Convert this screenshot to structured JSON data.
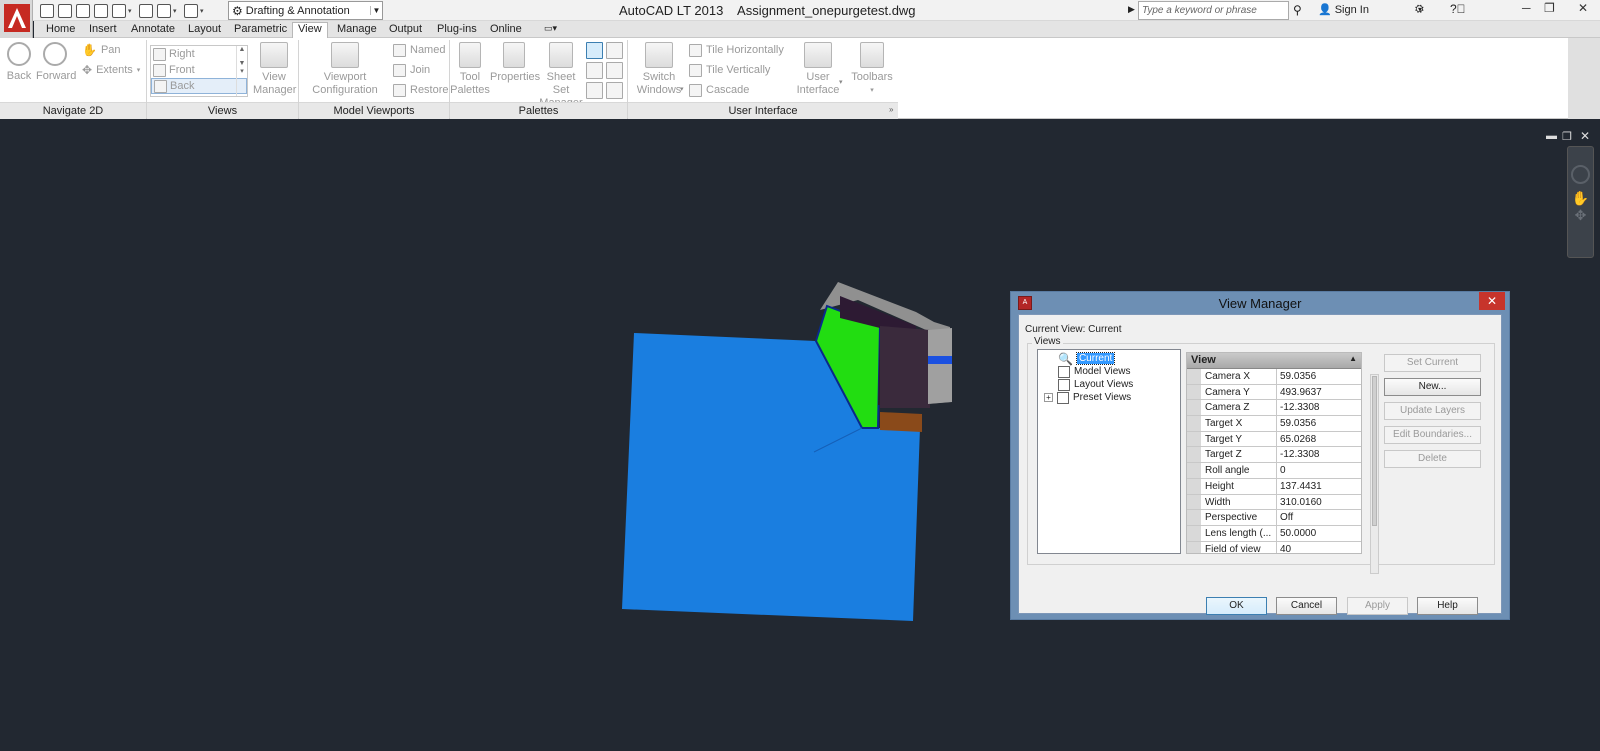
{
  "app": {
    "title": "AutoCAD LT 2013    Assignment_onepurgetest.dwg"
  },
  "workspace": {
    "value": "Drafting & Annotation"
  },
  "search": {
    "placeholder": "Type a keyword or phrase"
  },
  "account": {
    "signin": "Sign In"
  },
  "tabs": [
    "Home",
    "Insert",
    "Annotate",
    "Layout",
    "Parametric",
    "View",
    "Manage",
    "Output",
    "Plug-ins",
    "Online"
  ],
  "active_tab": "View",
  "ribbon": {
    "navigate2d": {
      "title": "Navigate 2D",
      "back": "Back",
      "forward": "Forward",
      "pan": "Pan",
      "extents": "Extents"
    },
    "views": {
      "title": "Views",
      "items": [
        "Right",
        "Front",
        "Back"
      ],
      "view_manager": [
        "View",
        "Manager"
      ]
    },
    "model_viewports": {
      "title": "Model Viewports",
      "viewport_config": [
        "Viewport",
        "Configuration"
      ],
      "named": "Named",
      "join": "Join",
      "restore": "Restore"
    },
    "palettes": {
      "title": "Palettes",
      "tool_palettes": [
        "Tool",
        "Palettes"
      ],
      "properties": "Properties",
      "sheet_set": [
        "Sheet Set",
        "Manager"
      ]
    },
    "user_interface": {
      "title": "User Interface",
      "switch_windows": [
        "Switch",
        "Windows"
      ],
      "tile_h": "Tile Horizontally",
      "tile_v": "Tile Vertically",
      "cascade": "Cascade",
      "user_interface": [
        "User",
        "Interface"
      ],
      "toolbars": "Toolbars"
    }
  },
  "dialog": {
    "title": "View Manager",
    "current_view": "Current View: Current",
    "group_label": "Views",
    "tree": [
      "Current",
      "Model Views",
      "Layout Views",
      "Preset Views"
    ],
    "props_header": "View",
    "props": [
      {
        "name": "Camera X",
        "value": "59.0356"
      },
      {
        "name": "Camera Y",
        "value": "493.9637"
      },
      {
        "name": "Camera Z",
        "value": "-12.3308"
      },
      {
        "name": "Target X",
        "value": "59.0356"
      },
      {
        "name": "Target Y",
        "value": "65.0268"
      },
      {
        "name": "Target Z",
        "value": "-12.3308"
      },
      {
        "name": "Roll angle",
        "value": "0"
      },
      {
        "name": "Height",
        "value": "137.4431"
      },
      {
        "name": "Width",
        "value": "310.0160"
      },
      {
        "name": "Perspective",
        "value": "Off"
      },
      {
        "name": "Lens length (...",
        "value": "50.0000"
      },
      {
        "name": "Field of view",
        "value": "40"
      }
    ],
    "side_buttons": [
      "Set Current",
      "New...",
      "Update Layers",
      "Edit Boundaries...",
      "Delete"
    ],
    "buttons": {
      "ok": "OK",
      "cancel": "Cancel",
      "apply": "Apply",
      "help": "Help"
    }
  },
  "colors": {
    "canvas": "#222831",
    "blue_face": "#1a7ee0",
    "green_face": "#22dd11"
  }
}
